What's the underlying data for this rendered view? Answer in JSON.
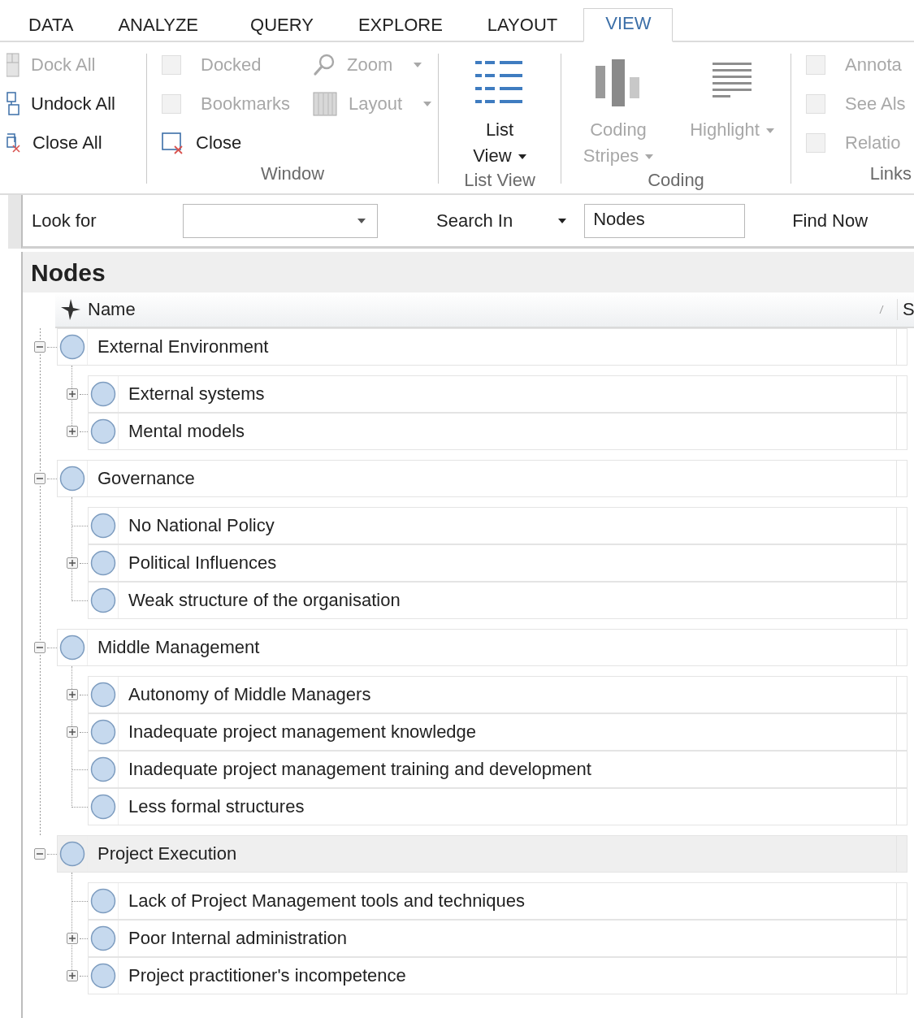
{
  "ribbon": {
    "tabs": [
      {
        "label": "DATA",
        "selected": false
      },
      {
        "label": "ANALYZE",
        "selected": false
      },
      {
        "label": "QUERY",
        "selected": false
      },
      {
        "label": "EXPLORE",
        "selected": false
      },
      {
        "label": "LAYOUT",
        "selected": false
      },
      {
        "label": "VIEW",
        "selected": true
      }
    ],
    "groups": [
      {
        "items": [
          {
            "kind": "button",
            "label": "Dock All",
            "disabled": true
          },
          {
            "kind": "button",
            "label": "Undock All",
            "disabled": false
          },
          {
            "kind": "button",
            "label": "Close All",
            "disabled": false
          }
        ]
      },
      {
        "label": "Window",
        "items": [
          {
            "kind": "checkbox",
            "label": "Docked",
            "checked": false,
            "disabled": true
          },
          {
            "kind": "checkbox",
            "label": "Bookmarks",
            "checked": false,
            "disabled": true
          },
          {
            "kind": "button",
            "label": "Close",
            "disabled": false
          },
          {
            "kind": "dropdown",
            "label": "Zoom",
            "disabled": true
          },
          {
            "kind": "dropdown",
            "label": "Layout",
            "disabled": true
          }
        ]
      },
      {
        "label": "List View",
        "items": [
          {
            "kind": "large-dropdown",
            "label": "List View",
            "disabled": false
          }
        ]
      },
      {
        "label": "Coding",
        "items": [
          {
            "kind": "large-dropdown",
            "label": "Coding Stripes",
            "disabled": true
          },
          {
            "kind": "large-dropdown",
            "label": "Highlight",
            "disabled": true
          }
        ]
      },
      {
        "label": "Links",
        "items": [
          {
            "kind": "checkbox",
            "label": "Annota",
            "checked": false,
            "disabled": true
          },
          {
            "kind": "checkbox",
            "label": "See Als",
            "checked": false,
            "disabled": true
          },
          {
            "kind": "checkbox",
            "label": "Relatio",
            "checked": false,
            "disabled": true
          }
        ]
      }
    ]
  },
  "search_bar": {
    "look_for_label": "Look for",
    "search_in_label": "Search In",
    "search_in_value": "Nodes",
    "find_button": "Find Now"
  },
  "nodes": {
    "title": "Nodes",
    "columns": [
      {
        "label": "Name"
      },
      {
        "label": "S"
      }
    ],
    "tree": [
      {
        "label": "External Environment",
        "expanded": true,
        "selected": false,
        "children": [
          {
            "label": "External systems",
            "has_children": true,
            "selected": false
          },
          {
            "label": "Mental models",
            "has_children": true,
            "selected": false
          }
        ]
      },
      {
        "label": "Governance",
        "expanded": true,
        "selected": false,
        "children": [
          {
            "label": "No National Policy",
            "has_children": false,
            "selected": false
          },
          {
            "label": "Political Influences",
            "has_children": true,
            "selected": false
          },
          {
            "label": "Weak structure of the organisation",
            "has_children": false,
            "selected": false
          }
        ]
      },
      {
        "label": "Middle Management",
        "expanded": true,
        "selected": false,
        "children": [
          {
            "label": "Autonomy of Middle Managers",
            "has_children": true,
            "selected": false
          },
          {
            "label": "Inadequate project management knowledge",
            "has_children": true,
            "selected": false
          },
          {
            "label": "Inadequate project management training and development",
            "has_children": false,
            "selected": false
          },
          {
            "label": "Less formal structures",
            "has_children": false,
            "selected": false
          }
        ]
      },
      {
        "label": "Project Execution",
        "expanded": true,
        "selected": true,
        "children": [
          {
            "label": "Lack of Project Management tools and techniques",
            "has_children": false,
            "selected": false
          },
          {
            "label": "Poor Internal administration",
            "has_children": true,
            "selected": false
          },
          {
            "label": "Project practitioner's incompetence",
            "has_children": true,
            "selected": false
          }
        ]
      }
    ]
  }
}
